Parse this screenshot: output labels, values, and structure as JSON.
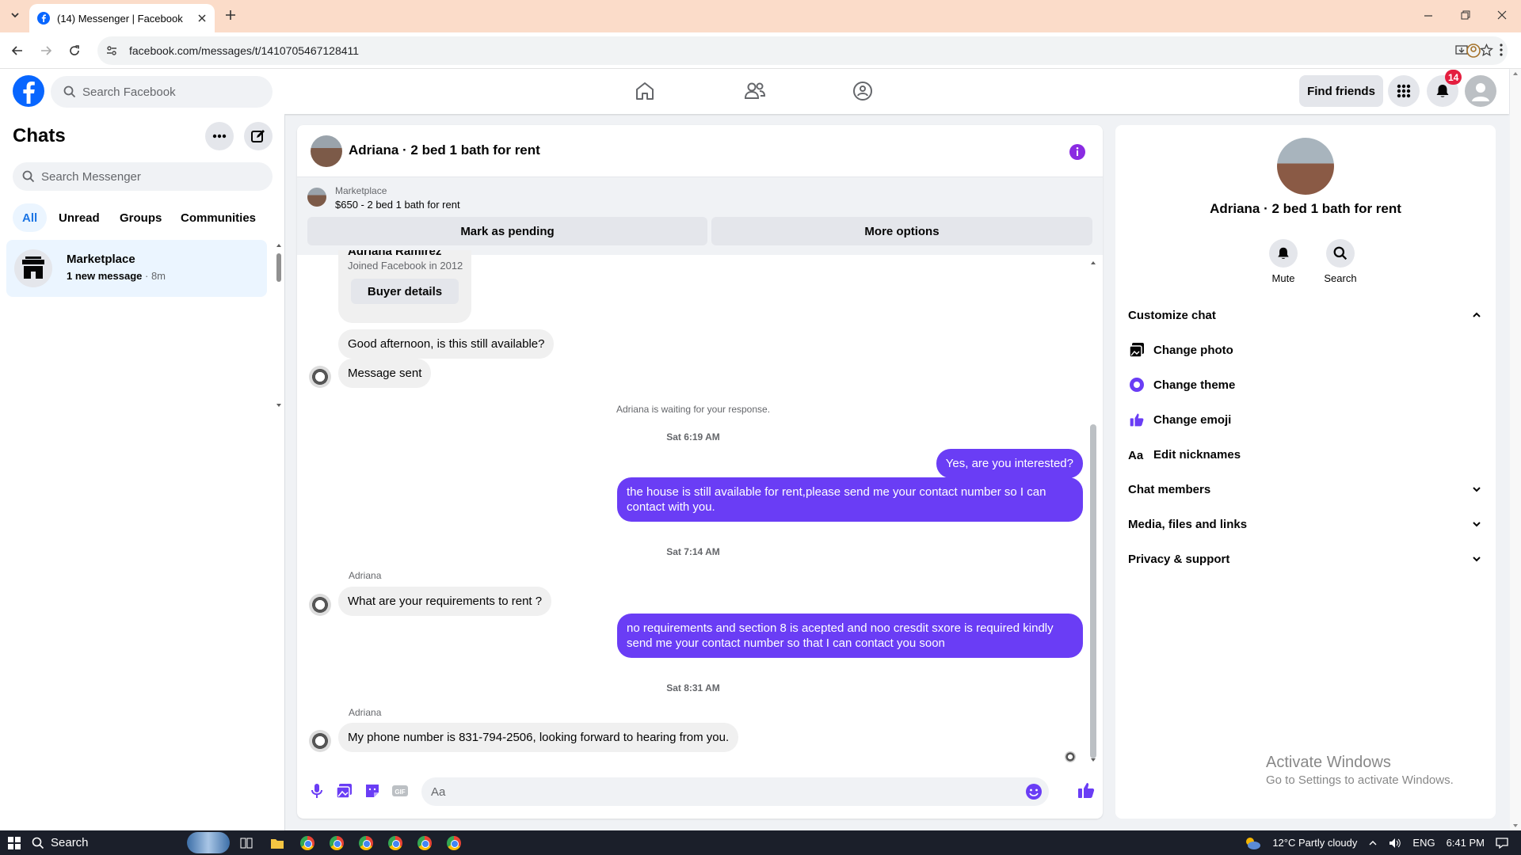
{
  "browser": {
    "tab_title": "(14) Messenger | Facebook",
    "url": "facebook.com/messages/t/1410705467128411"
  },
  "fb_nav": {
    "search_placeholder": "Search Facebook",
    "find_friends_label": "Find friends",
    "notification_count": "14"
  },
  "sidebar": {
    "title": "Chats",
    "search_placeholder": "Search Messenger",
    "filters": [
      "All",
      "Unread",
      "Groups",
      "Communities"
    ],
    "active_filter": "All",
    "conversation": {
      "name": "Marketplace",
      "preview": "1 new message",
      "time": " · 8m"
    }
  },
  "chat": {
    "header_name": "Adriana · 2 bed 1 bath for rent",
    "marketplace": {
      "label": "Marketplace",
      "listing": "$650 - 2 bed 1 bath for rent",
      "mark_pending": "Mark as pending",
      "more_options": "More options"
    },
    "buyer_card": {
      "name": "Adriana Ramirez",
      "joined": "Joined Facebook in 2012",
      "details_button": "Buyer details"
    },
    "messages": {
      "m1": "Good afternoon, is this still available?",
      "m2": "Message sent",
      "waiting": "Adriana is waiting for your response.",
      "ts1": "Sat 6:19 AM",
      "m3": "Yes, are you interested?",
      "m4": "the house is still available for rent,please send me your contact number so I can contact with you.",
      "ts2": "Sat 7:14 AM",
      "sender1": "Adriana",
      "m5": "What are your requirements to rent ?",
      "m6": "no requirements and section 8 is acepted and noo cresdit sxore is required kindly send me your contact number so that I can contact you soon",
      "ts3": "Sat 8:31 AM",
      "sender2": "Adriana",
      "m7": "My phone number is 831-794-2506, looking forward to hearing from you."
    },
    "composer_placeholder": "Aa"
  },
  "info_panel": {
    "name": "Adriana · 2 bed 1 bath for rent",
    "mute_label": "Mute",
    "search_label": "Search",
    "customize_chat": "Customize chat",
    "change_photo": "Change photo",
    "change_theme": "Change theme",
    "change_emoji": "Change emoji",
    "edit_nicknames": "Edit nicknames",
    "chat_members": "Chat members",
    "media_files_links": "Media, files and links",
    "privacy_support": "Privacy & support",
    "watermark_title": "Activate Windows",
    "watermark_sub": "Go to Settings to activate Windows."
  },
  "taskbar": {
    "search_label": "Search",
    "weather": "12°C  Partly cloudy",
    "language": "ENG",
    "time": "6:41 PM"
  },
  "colors": {
    "accent_purple": "#6a3df5",
    "fb_blue": "#0866ff",
    "notification_red": "#e41e3f"
  }
}
